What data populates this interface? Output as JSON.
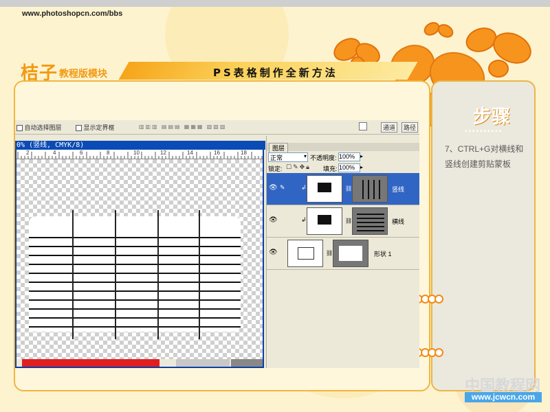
{
  "site": {
    "url": "www.photoshopcn.com/bbs"
  },
  "brand": {
    "logo": "桔子",
    "sub": "教程版模块"
  },
  "page": {
    "title": "PS表格制作全新方法"
  },
  "side": {
    "heading": "步骤",
    "dots": "••••••••••",
    "step_text": "7、CTRL+G对横线和竖线创建剪贴蒙板"
  },
  "photoshop": {
    "toolbar": {
      "auto_select": "自动选择图层",
      "show_bounds": "显示定界框",
      "tab_channels": "通道",
      "tab_paths": "路径"
    },
    "document": {
      "title": "0% (竖线, CMYK/8)",
      "ruler_ticks": [
        "2",
        "4",
        "6",
        "8",
        "10",
        "12",
        "14",
        "16",
        "18"
      ]
    },
    "layers": {
      "tab": "图层",
      "blend_mode": "正常",
      "opacity_label": "不透明度:",
      "opacity_value": "100%",
      "lock_label": "锁定:",
      "fill_label": "填充:",
      "fill_value": "100%",
      "items": [
        {
          "name": "竖线",
          "selected": true
        },
        {
          "name": "横线",
          "selected": false
        },
        {
          "name": "形状 1",
          "selected": false
        }
      ]
    }
  },
  "watermark": {
    "cn": "中国教程网",
    "en": "www.jcwcn.com"
  },
  "colors": {
    "accent": "#f29a12",
    "selection": "#3165c4",
    "title_bar": "#0a4bb5"
  }
}
